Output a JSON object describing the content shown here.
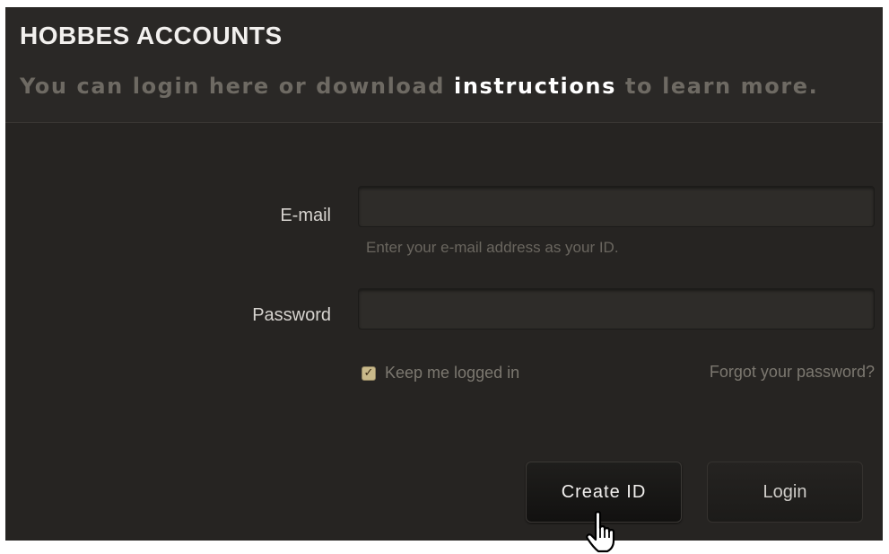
{
  "header": {
    "title": "HOBBES ACCOUNTS",
    "subtitle_before": "You can login here or download ",
    "subtitle_link": "instructions",
    "subtitle_after": " to learn more."
  },
  "form": {
    "email_label": "E-mail",
    "email_value": "",
    "email_hint": "Enter your e-mail address as your ID.",
    "password_label": "Password",
    "password_value": "",
    "keep_logged_in_label": "Keep me logged in",
    "keep_logged_in_checked": true,
    "forgot_password": "Forgot your password?"
  },
  "buttons": {
    "create_id": "Create ID",
    "login": "Login"
  },
  "colors": {
    "panel_bg": "#262422",
    "title": "#f2f0ee",
    "subtitle": "#6e6a63",
    "link": "#ffffff",
    "checkbox": "#c9b98a"
  },
  "icons": {
    "checkbox": "checkmark-icon",
    "cursor": "hand-pointer-icon"
  }
}
